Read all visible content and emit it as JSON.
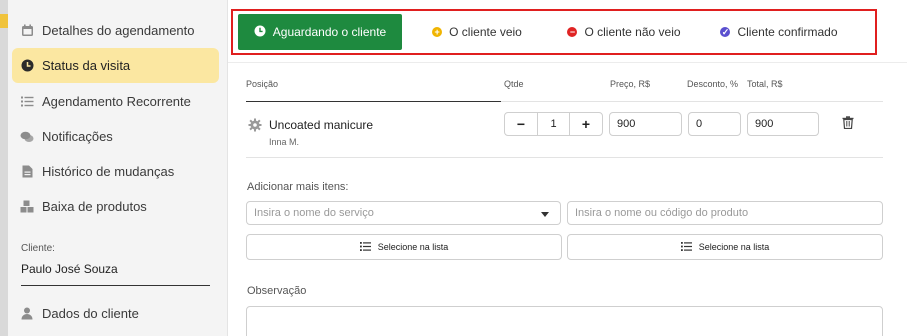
{
  "sidebar": {
    "items": [
      {
        "label": "Detalhes do agendamento",
        "icon": "calendar-icon",
        "active": false
      },
      {
        "label": "Status da visita",
        "icon": "clock-icon",
        "active": true
      },
      {
        "label": "Agendamento Recorrente",
        "icon": "list-icon",
        "active": false
      },
      {
        "label": "Notificações",
        "icon": "chat-icon",
        "active": false
      },
      {
        "label": "Histórico de mudanças",
        "icon": "document-icon",
        "active": false
      },
      {
        "label": "Baixa de produtos",
        "icon": "boxes-icon",
        "active": false
      }
    ],
    "client_label": "Cliente:",
    "client_name": "Paulo  José Souza",
    "client_data_label": "Dados do cliente"
  },
  "status": {
    "tabs": [
      {
        "label": "Aguardando o cliente",
        "icon": "clock-icon",
        "color": "#1e8a3f",
        "active": true
      },
      {
        "label": "O cliente veio",
        "icon": "plus-circle-icon",
        "color": "#f0b400",
        "active": false
      },
      {
        "label": "O cliente não veio",
        "icon": "minus-circle-icon",
        "color": "#e02424",
        "active": false
      },
      {
        "label": "Cliente confirmado",
        "icon": "check-circle-icon",
        "color": "#5a4fcf",
        "active": false
      }
    ]
  },
  "table": {
    "headers": {
      "position": "Posição",
      "qty": "Qtde",
      "price": "Preço, R$",
      "discount": "Desconto, %",
      "total": "Total, R$"
    },
    "row": {
      "service": "Uncoated manicure",
      "staff": "Inna M.",
      "minus": "−",
      "qty": "1",
      "plus": "+",
      "price": "900",
      "discount": "0",
      "total": "900"
    }
  },
  "add_items": {
    "label": "Adicionar mais itens:",
    "service_placeholder": "Insira o nome do serviço",
    "product_placeholder": "Insira o nome ou código do produto",
    "select_service_label": "Selecione na lista",
    "select_product_label": "Selecione na lista"
  },
  "notes": {
    "label": "Observação"
  },
  "colors": {
    "accent_active": "#1e8a3f",
    "sidebar_active": "#fbe7a1",
    "highlight_border": "#e01f1f"
  }
}
